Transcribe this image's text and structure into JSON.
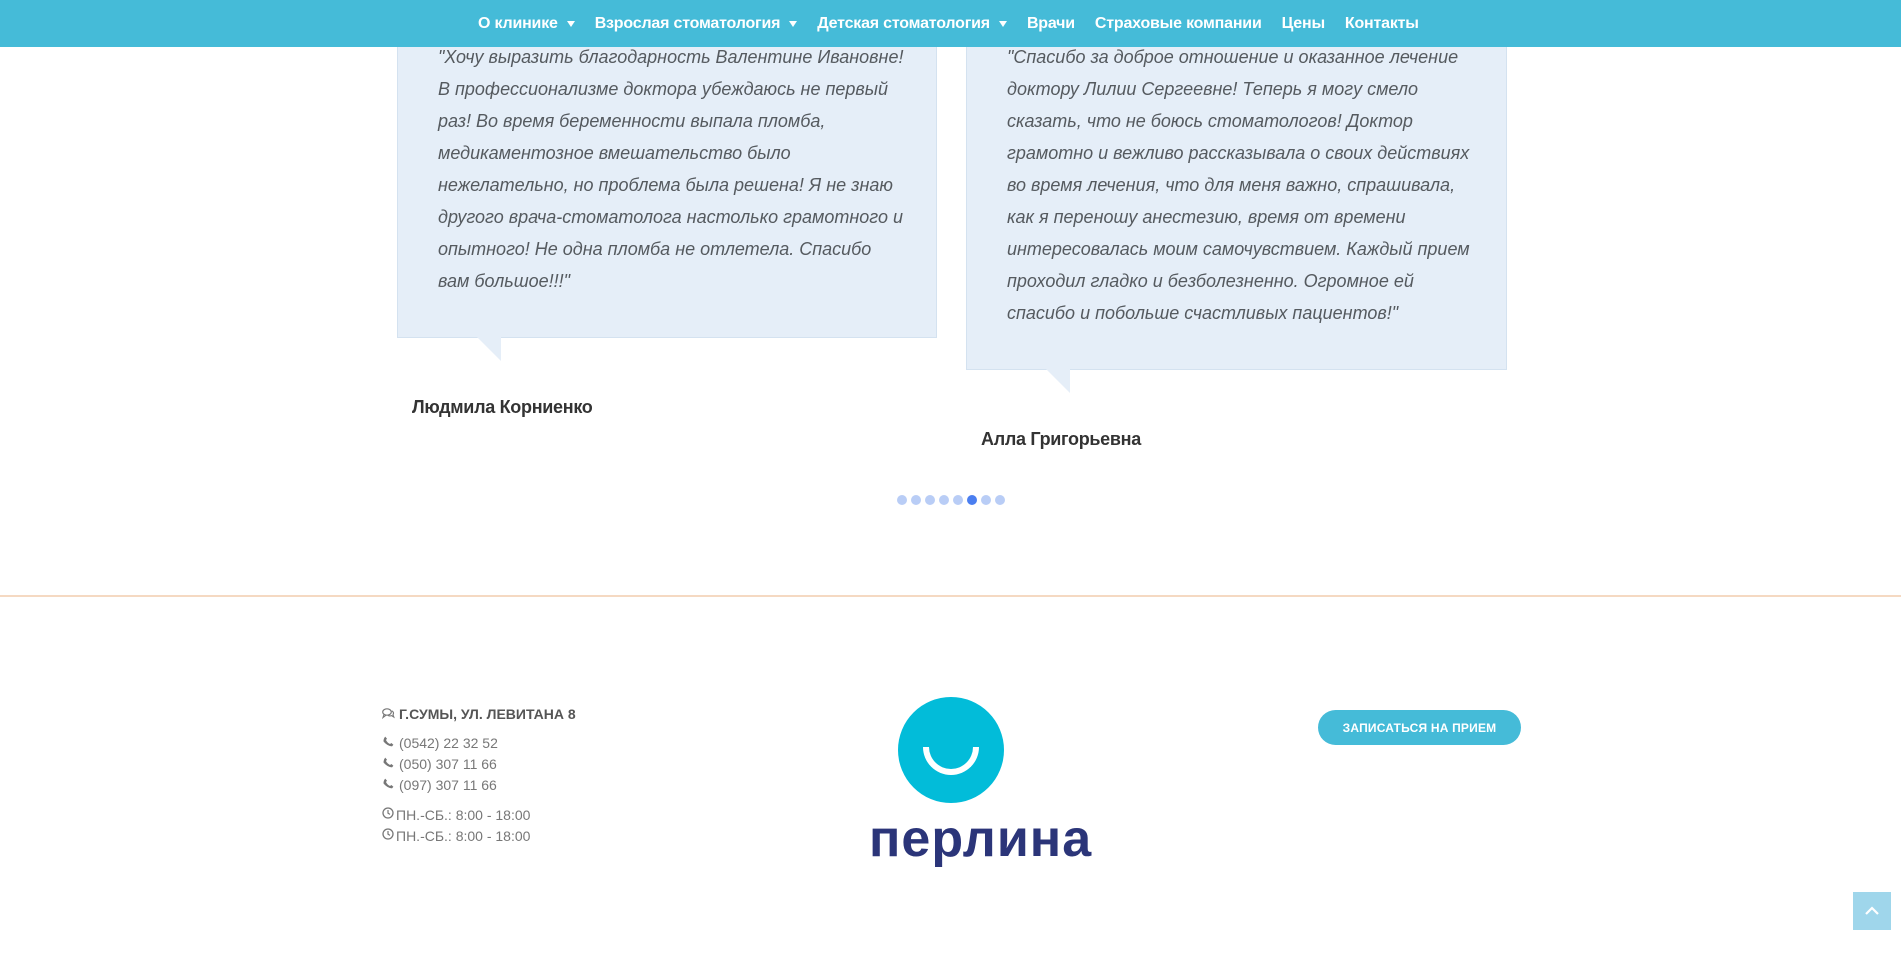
{
  "nav": {
    "items": [
      {
        "label": "О клинике",
        "has_dropdown": true
      },
      {
        "label": "Взрослая стоматология",
        "has_dropdown": true
      },
      {
        "label": "Детская стоматология",
        "has_dropdown": true
      },
      {
        "label": "Врачи",
        "has_dropdown": false
      },
      {
        "label": "Страховые компании",
        "has_dropdown": false
      },
      {
        "label": "Цены",
        "has_dropdown": false
      },
      {
        "label": "Контакты",
        "has_dropdown": false
      }
    ]
  },
  "testimonials": [
    {
      "quote": "\"Хочу выразить благодарность Валентине Ивановне! В профессионализме доктора убеждаюсь не первый раз! Во время беременности выпала пломба, медикаментозное вмешательство было нежелательно, но проблема была решена! Я не знаю другого врача-стоматолога настолько грамотного и опытного! Не одна пломба не отлетела. Спасибо вам большое!!!\"",
      "author": "Людмила Корниенко"
    },
    {
      "quote": "\"Спасибо за доброе отношение и оказанное лечение доктору Лилии Сергеевне! Теперь я могу смело сказать, что не боюсь стоматологов! Доктор грамотно и вежливо рассказывала о своих действиях во время лечения, что для меня важно, спрашивала, как я переношу анестезию, время от времени интересовалась моим самочувствием. Каждый прием проходил гладко и безболезненно. Огромное ей спасибо и побольше счастливых пациентов!\"",
      "author": "Алла Григорьевна"
    }
  ],
  "carousel": {
    "total": 8,
    "active_index": 5
  },
  "footer": {
    "address": "Г.СУМЫ, УЛ. ЛЕВИТАНА 8",
    "phones": [
      "(0542) 22 32 52",
      "(050) 307 11 66",
      "(097) 307 11 66"
    ],
    "hours": [
      "ПН.-СБ.: 8:00 - 18:00",
      "ПН.-СБ.: 8:00 - 18:00"
    ],
    "logo_text": "перлина",
    "cta_label": "ЗАПИСАТЬСЯ НА ПРИЕМ"
  },
  "icons": {
    "address": "comments-icon",
    "phone": "phone-icon",
    "hours": "clock-icon",
    "scroll_top": "chevron-up-icon",
    "nav_dropdown": "caret-down-icon"
  },
  "colors": {
    "nav_bg": "#45bbd8",
    "bubble_bg": "#e5eef8",
    "dot_active": "#4a7ef0",
    "dot_inactive": "#b9cdf6",
    "logo_circle": "#02bcd9",
    "logo_text": "#2b3579",
    "divider": "#f5d9c2"
  }
}
